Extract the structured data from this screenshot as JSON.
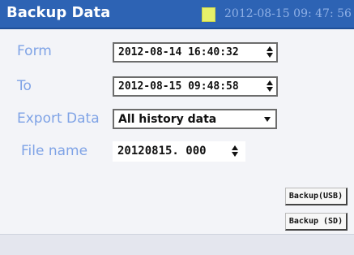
{
  "header": {
    "title": "Backup Data",
    "clock": "2012-08-15 09: 47: 56"
  },
  "form": {
    "from_label": "Form",
    "from_value": "2012-08-14 16:40:32",
    "to_label": "To",
    "to_value": "2012-08-15 09:48:58",
    "export_label": "Export Data",
    "export_value": "All history data",
    "filename_label": "File name",
    "filename_value": "20120815. 000"
  },
  "buttons": {
    "backup_usb": "Backup(USB)",
    "backup_sd": "Backup (SD)"
  },
  "colors": {
    "title_bar": "#2d63b4",
    "label": "#7fa3e6",
    "status_block": "#e6f06a"
  }
}
